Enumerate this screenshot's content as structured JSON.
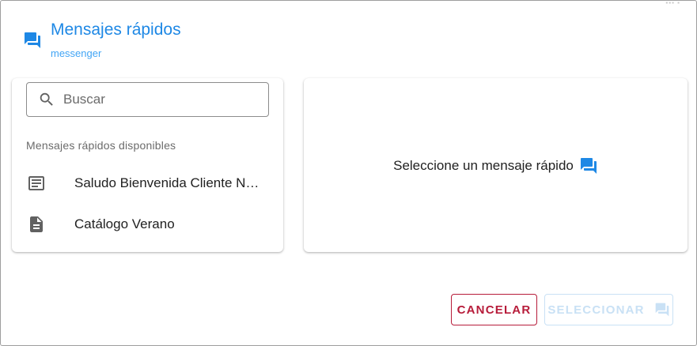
{
  "header": {
    "title": "Mensajes rápidos",
    "subtitle": "messenger",
    "icon": "forum-icon"
  },
  "search": {
    "placeholder": "Buscar",
    "value": "",
    "icon": "search-icon"
  },
  "list": {
    "heading": "Mensajes rápidos disponibles",
    "items": [
      {
        "label": "Saludo Bienvenida Cliente Nuevo",
        "icon": "subject-icon"
      },
      {
        "label": "Catálogo Verano",
        "icon": "document-icon"
      }
    ]
  },
  "preview": {
    "empty_text": "Seleccione un mensaje rápido",
    "icon": "forum-icon"
  },
  "footer": {
    "cancel_label": "CANCELAR",
    "select_label": "SELECCIONAR",
    "select_enabled": false
  },
  "colors": {
    "accent": "#1e88e5",
    "subtitle": "#42a5f5",
    "cancel": "#b71c3a",
    "disabled": "#c9e1f5",
    "icon_grey": "#616161"
  }
}
